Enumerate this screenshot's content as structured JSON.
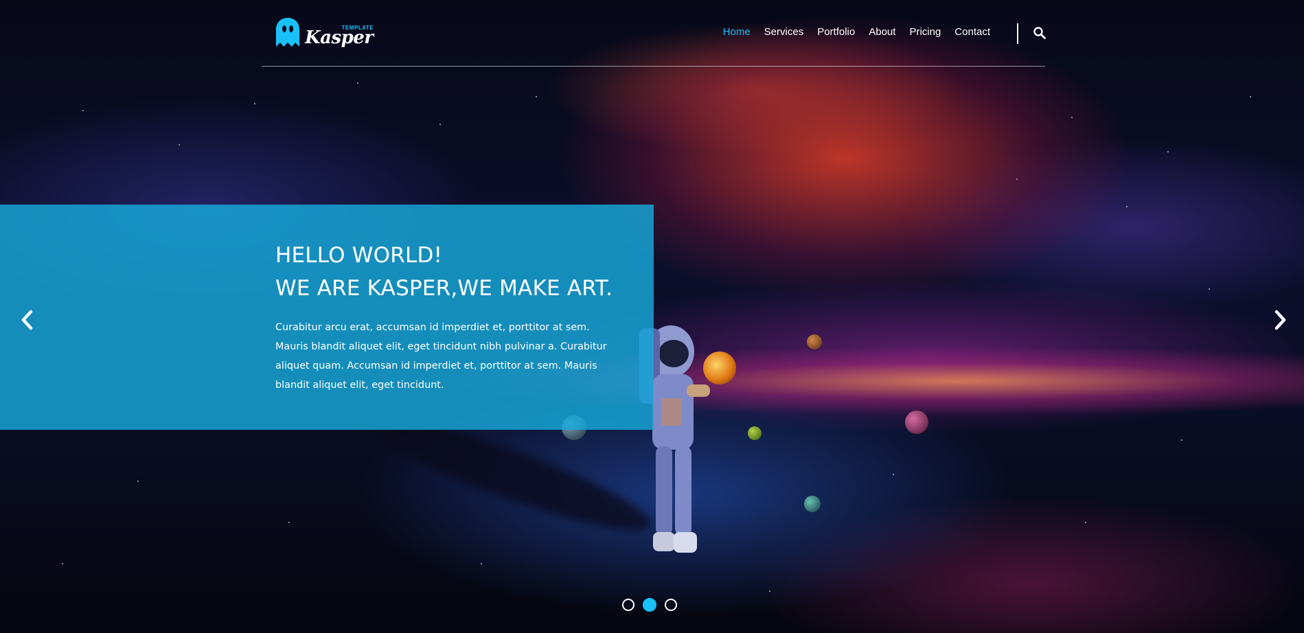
{
  "brand": {
    "logo_main": "Kasper",
    "logo_tag": "TEMPLATE",
    "accent_color": "#19c1fb"
  },
  "nav": {
    "items": [
      {
        "label": "Home",
        "active": true
      },
      {
        "label": "Services",
        "active": false
      },
      {
        "label": "Portfolio",
        "active": false
      },
      {
        "label": "About",
        "active": false
      },
      {
        "label": "Pricing",
        "active": false
      },
      {
        "label": "Contact",
        "active": false
      }
    ],
    "search_icon": "search-icon"
  },
  "slide": {
    "headline_line1": "HELLO WORLD!",
    "headline_line2": "WE ARE KASPER,WE MAKE ART.",
    "body": "Curabitur arcu erat, accumsan id imperdiet et, porttitor at sem. Mauris blandit aliquet elit, eget tincidunt nibh pulvinar a. Curabitur aliquet quam. Accumsan id imperdiet et, porttitor at sem. Mauris blandit aliquet elit, eget tincidunt.",
    "panel_color": "#17aadc"
  },
  "carousel": {
    "prev_icon": "chevron-left-icon",
    "next_icon": "chevron-right-icon",
    "total_slides": 3,
    "active_slide": 2
  }
}
